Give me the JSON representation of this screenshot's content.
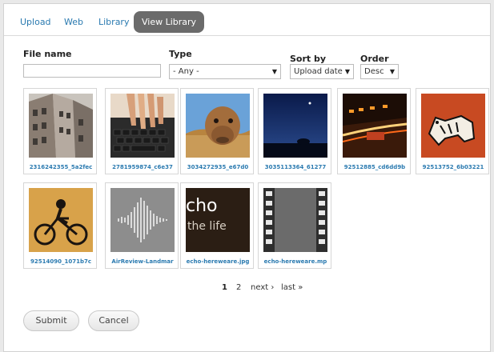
{
  "tabs": [
    {
      "label": "Upload"
    },
    {
      "label": "Web"
    },
    {
      "label": "Library"
    },
    {
      "label": "View Library",
      "active": true
    }
  ],
  "filters": {
    "file_name_label": "File name",
    "file_name_value": "",
    "type_label": "Type",
    "type_value": "- Any -",
    "sort_label": "Sort by",
    "sort_value": "Upload date",
    "order_label": "Order",
    "order_value": "Desc"
  },
  "items": [
    {
      "caption": "2316242355_5a2fec",
      "kind": "building-photo"
    },
    {
      "caption": "2781959874_c6e37",
      "kind": "keyboard-photo"
    },
    {
      "caption": "3034272935_e67d0",
      "kind": "camel-photo"
    },
    {
      "caption": "3035113364_61277",
      "kind": "night-sky-photo"
    },
    {
      "caption": "92512885_cd6dd9b",
      "kind": "street-night-photo"
    },
    {
      "caption": "92513752_6b03221",
      "kind": "graffiti-animal-photo"
    },
    {
      "caption": "92514090_1071b7c",
      "kind": "graffiti-bike-photo"
    },
    {
      "caption": "AirReview-Landmar",
      "kind": "audio-waveform-icon"
    },
    {
      "caption": "echo-hereweare.jpg",
      "kind": "echo-image",
      "overlay_line1": "cho",
      "overlay_line2": "the life"
    },
    {
      "caption": "echo-hereweare.mp",
      "kind": "video-film-icon"
    }
  ],
  "pager": {
    "current": "1",
    "page2": "2",
    "next": "next ›",
    "last": "last »"
  },
  "buttons": {
    "submit": "Submit",
    "cancel": "Cancel"
  },
  "colors": {
    "link": "#2a7ab0",
    "active_tab": "#6b6b6b"
  }
}
